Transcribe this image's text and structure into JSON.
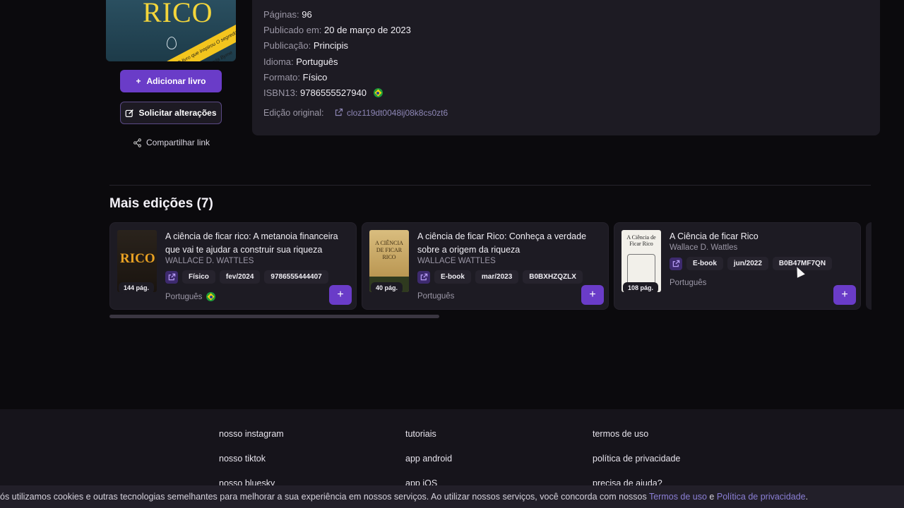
{
  "cover": {
    "title_fragment": "RICO",
    "band_text": "O livro que inspirou O segredo, de Rhonda Byrne"
  },
  "sidebar": {
    "add_label": "Adicionar livro",
    "request_label": "Solicitar alterações",
    "share_label": "Compartilhar link"
  },
  "details": {
    "pages_label": "Páginas:",
    "pages_value": "96",
    "published_label": "Publicado em:",
    "published_value": "20 de março de 2023",
    "publisher_label": "Publicação:",
    "publisher_value": "Principis",
    "language_label": "Idioma:",
    "language_value": "Português",
    "format_label": "Formato:",
    "format_value": "Físico",
    "isbn_label": "ISBN13:",
    "isbn_value": "9786555527940",
    "original_label": "Edição original:",
    "original_value": "cloz119dt0048ij08k8cs0zt6"
  },
  "editions": {
    "title": "Mais edições (7)",
    "cards": [
      {
        "title": "A ciência de ficar rico: A metanoia financeira que vai te ajudar a construir sua riqueza",
        "author": "WALLACE D. WATTLES",
        "format": "Físico",
        "date": "fev/2024",
        "code": "9786555444407",
        "language": "Português",
        "pages": "144 pág.",
        "cover_text": "RICO"
      },
      {
        "title": "A ciência de ficar Rico: Conheça a verdade sobre a origem da riqueza",
        "author": "WALLACE WATTLES",
        "format": "E-book",
        "date": "mar/2023",
        "code": "B0BXHZQZLX",
        "language": "Português",
        "pages": "40 pág.",
        "cover_text": "A CIÊNCIA DE FICAR RICO"
      },
      {
        "title": "A Ciência de ficar Rico",
        "author": "Wallace D. Wattles",
        "format": "E-book",
        "date": "jun/2022",
        "code": "B0B47MF7QN",
        "language": "Português",
        "pages": "108 pág.",
        "cover_text": "A Ciência de Ficar Rico"
      }
    ]
  },
  "footer": {
    "col1": [
      "nosso instagram",
      "nosso tiktok",
      "nosso bluesky"
    ],
    "col2": [
      "tutoriais",
      "app android",
      "app iOS"
    ],
    "col3": [
      "termos de uso",
      "política de privacidade",
      "precisa de ajuda?"
    ]
  },
  "cookie": {
    "text": "ós utilizamos cookies e outras tecnologias semelhantes para melhorar a sua experiência em nossos serviços. Ao utilizar nossos serviços, você concorda com nossos ",
    "terms": "Termos de uso",
    "and": " e ",
    "privacy": "Política de privacidade",
    "end": "."
  },
  "colors": {
    "accent": "#6a3cc8",
    "background": "#0b0a0d",
    "panel": "#1d1b23"
  }
}
